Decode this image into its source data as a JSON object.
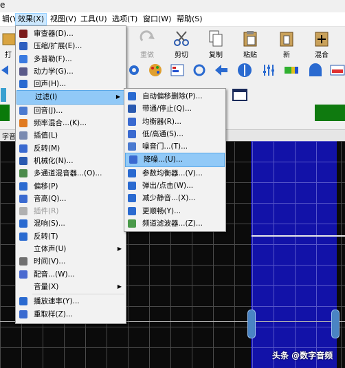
{
  "corner_text": "e",
  "menubar": {
    "items": [
      {
        "label": "辑(Y)"
      },
      {
        "label": "效果(X)"
      },
      {
        "label": "视图(V)"
      },
      {
        "label": "工具(U)"
      },
      {
        "label": "选项(T)"
      },
      {
        "label": "窗口(W)"
      },
      {
        "label": "帮助(S)"
      }
    ]
  },
  "toolbar": {
    "buttons": [
      {
        "label": "打",
        "icon": "open-icon"
      },
      {
        "label": "重做",
        "icon": "redo-icon",
        "disabled": true
      },
      {
        "label": "剪切",
        "icon": "scissors-icon"
      },
      {
        "label": "复制",
        "icon": "copy-icon"
      },
      {
        "label": "粘贴",
        "icon": "paste-icon"
      },
      {
        "label": "新",
        "icon": "new-icon"
      },
      {
        "label": "混合",
        "icon": "mix-icon"
      }
    ]
  },
  "tab_label": "字音",
  "effects_menu": {
    "items": [
      {
        "label": "审查器(D)...",
        "icon": "inspector-icon",
        "color": "#7a1a1a"
      },
      {
        "label": "压缩/扩展(E)...",
        "icon": "compress-icon",
        "color": "#2f5fbf"
      },
      {
        "label": "多普勒(F)...",
        "icon": "doppler-icon",
        "color": "#3a7ae0"
      },
      {
        "label": "动力学(G)...",
        "icon": "dynamics-icon",
        "color": "#5a5a8a"
      },
      {
        "label": "回声(H)...",
        "icon": "echo-icon",
        "color": "#2a6ad0"
      },
      {
        "label": "过滤(I)",
        "icon": "",
        "submenu": true,
        "highlighted": true
      },
      {
        "label": "回音(J)...",
        "icon": "reverb-icon",
        "color": "#4a7ad0"
      },
      {
        "label": "频率混合...(K)...",
        "icon": "freq-mix-icon",
        "color": "#e07a20"
      },
      {
        "label": "插值(L)",
        "icon": "interpolate-icon",
        "color": "#7a8ab0"
      },
      {
        "label": "反转(M)",
        "icon": "invert-icon",
        "color": "#3a6ad0"
      },
      {
        "label": "机械化(N)...",
        "icon": "mechanize-icon",
        "color": "#2a5ab0"
      },
      {
        "label": "多通道混音器...(O)...",
        "icon": "multichannel-icon",
        "color": "#4a8a4a"
      },
      {
        "label": "偏移(P)",
        "icon": "offset-icon",
        "color": "#2a6ad0"
      },
      {
        "label": "音高(Q)...",
        "icon": "pitch-icon",
        "color": "#3a6ad0"
      },
      {
        "label": "插件(R)",
        "icon": "plugin-icon",
        "color": "#b0b0b0",
        "disabled": true
      },
      {
        "label": "混响(S)...",
        "icon": "reverb2-icon",
        "color": "#2a6ad0"
      },
      {
        "label": "反转(T)",
        "icon": "reverse-icon",
        "color": "#2a6ad0"
      },
      {
        "label": "立体声(U)",
        "icon": "",
        "submenu": true
      },
      {
        "label": "时间(V)...",
        "icon": "clock-icon",
        "color": "#707070"
      },
      {
        "label": "配音...(W)...",
        "icon": "voiceover-icon",
        "color": "#4a6ad0"
      },
      {
        "label": "音量(X)",
        "icon": "",
        "submenu": true
      },
      {
        "sep": true
      },
      {
        "label": "播放速率(Y)...",
        "icon": "speed-icon",
        "color": "#2a6ad0"
      },
      {
        "label": "重取样(Z)...",
        "icon": "resample-icon",
        "color": "#3a6ad0"
      }
    ]
  },
  "filter_submenu": {
    "items": [
      {
        "label": "自动偏移删除(P)...",
        "icon": "dc-offset-icon",
        "color": "#2a6ad0"
      },
      {
        "label": "带通/停止(Q)...",
        "icon": "bandpass-icon",
        "color": "#2a5ab0"
      },
      {
        "label": "均衡器(R)...",
        "icon": "equalizer-icon",
        "color": "#3a6ad0"
      },
      {
        "label": "低/高通(S)...",
        "icon": "lowhigh-pass-icon",
        "color": "#3a6ad0"
      },
      {
        "label": "噪音门...(T)...",
        "icon": "noise-gate-icon",
        "color": "#4a7ad0"
      },
      {
        "label": "降噪...(U)...",
        "icon": "noise-reduction-icon",
        "color": "#3a6ad0",
        "highlighted": true
      },
      {
        "label": "参数均衡器...(V)...",
        "icon": "param-eq-icon",
        "color": "#2a6ad0"
      },
      {
        "label": "弹出/点击(W)...",
        "icon": "pop-click-icon",
        "color": "#2a6ad0"
      },
      {
        "label": "减少静音...(X)...",
        "icon": "reduce-silence-icon",
        "color": "#2a6ad0"
      },
      {
        "label": "更顺畅(Y)...",
        "icon": "smooth-icon",
        "color": "#2a6ad0"
      },
      {
        "label": "频道滤波器...(Z)...",
        "icon": "channel-filter-icon",
        "color": "#4a9a4a"
      }
    ]
  },
  "watermark": "头条 @数字音频"
}
